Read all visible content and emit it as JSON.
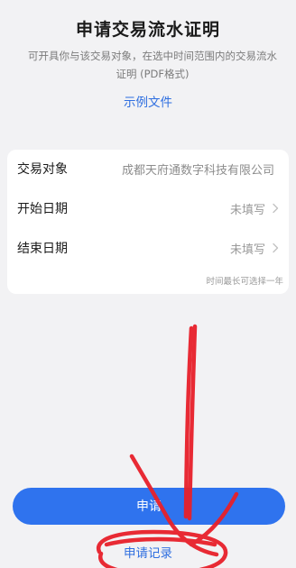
{
  "header": {
    "title": "申请交易流水证明",
    "description": "可开具你与该交易对象，在选中时间范围内的交易流水证明 (PDF格式)",
    "sample_link": "示例文件"
  },
  "form": {
    "counterparty": {
      "label": "交易对象",
      "value": "成都天府通数字科技有限公司"
    },
    "start_date": {
      "label": "开始日期",
      "value": "未填写"
    },
    "end_date": {
      "label": "结束日期",
      "value": "未填写"
    },
    "hint": "时间最长可选择一年"
  },
  "actions": {
    "apply_label": "申请",
    "records_label": "申请记录"
  },
  "annotation": {
    "color": "#e8202a"
  }
}
